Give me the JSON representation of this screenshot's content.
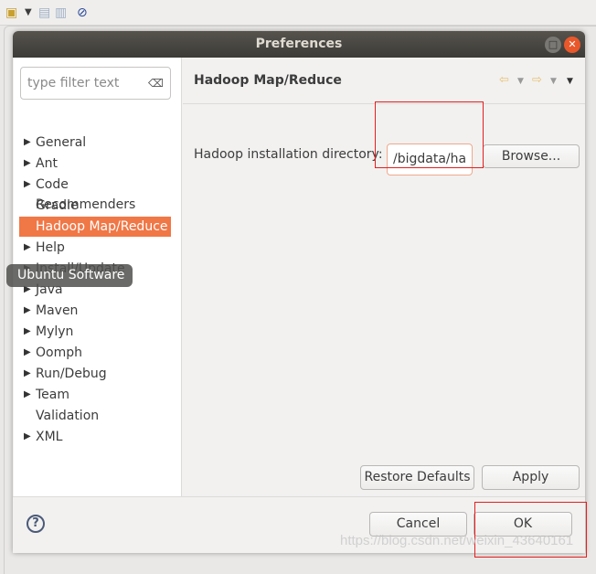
{
  "toolbar": {
    "icons": [
      "new-wizard-icon",
      "dropdown-icon",
      "save-icon",
      "save-all-icon",
      "skip-breakpoints-icon"
    ]
  },
  "dialog": {
    "title": "Preferences"
  },
  "filter": {
    "placeholder": "type filter text"
  },
  "tree": [
    {
      "label": "General",
      "expandable": true
    },
    {
      "label": "Ant",
      "expandable": true
    },
    {
      "label": "Code Recommenders",
      "expandable": true
    },
    {
      "label": "Gradle",
      "expandable": false
    },
    {
      "label": "Hadoop Map/Reduce",
      "expandable": false,
      "selected": true
    },
    {
      "label": "Help",
      "expandable": true
    },
    {
      "label": "Install/Update",
      "expandable": true
    },
    {
      "label": "Java",
      "expandable": true
    },
    {
      "label": "Maven",
      "expandable": true
    },
    {
      "label": "Mylyn",
      "expandable": true
    },
    {
      "label": "Oomph",
      "expandable": true
    },
    {
      "label": "Run/Debug",
      "expandable": true
    },
    {
      "label": "Team",
      "expandable": true
    },
    {
      "label": "Validation",
      "expandable": false
    },
    {
      "label": "XML",
      "expandable": true
    }
  ],
  "page": {
    "title": "Hadoop Map/Reduce",
    "field_label": "Hadoop installation directory:",
    "field_value": "/bigdata/ha",
    "browse": "Browse...",
    "restore": "Restore Defaults",
    "apply": "Apply"
  },
  "footer": {
    "cancel": "Cancel",
    "ok": "OK"
  },
  "tooltip": "Ubuntu Software",
  "watermark": "https://blog.csdn.net/weixin_43640161",
  "colors": {
    "selection": "#f07746",
    "highlight_box": "#e41e1e",
    "titlebar": "#3c3b37"
  }
}
